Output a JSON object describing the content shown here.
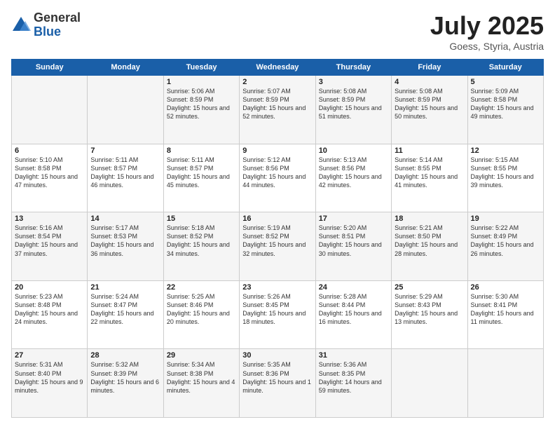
{
  "logo": {
    "general": "General",
    "blue": "Blue"
  },
  "header": {
    "month": "July 2025",
    "location": "Goess, Styria, Austria"
  },
  "weekdays": [
    "Sunday",
    "Monday",
    "Tuesday",
    "Wednesday",
    "Thursday",
    "Friday",
    "Saturday"
  ],
  "weeks": [
    [
      {
        "day": "",
        "sunrise": "",
        "sunset": "",
        "daylight": ""
      },
      {
        "day": "",
        "sunrise": "",
        "sunset": "",
        "daylight": ""
      },
      {
        "day": "1",
        "sunrise": "Sunrise: 5:06 AM",
        "sunset": "Sunset: 8:59 PM",
        "daylight": "Daylight: 15 hours and 52 minutes."
      },
      {
        "day": "2",
        "sunrise": "Sunrise: 5:07 AM",
        "sunset": "Sunset: 8:59 PM",
        "daylight": "Daylight: 15 hours and 52 minutes."
      },
      {
        "day": "3",
        "sunrise": "Sunrise: 5:08 AM",
        "sunset": "Sunset: 8:59 PM",
        "daylight": "Daylight: 15 hours and 51 minutes."
      },
      {
        "day": "4",
        "sunrise": "Sunrise: 5:08 AM",
        "sunset": "Sunset: 8:59 PM",
        "daylight": "Daylight: 15 hours and 50 minutes."
      },
      {
        "day": "5",
        "sunrise": "Sunrise: 5:09 AM",
        "sunset": "Sunset: 8:58 PM",
        "daylight": "Daylight: 15 hours and 49 minutes."
      }
    ],
    [
      {
        "day": "6",
        "sunrise": "Sunrise: 5:10 AM",
        "sunset": "Sunset: 8:58 PM",
        "daylight": "Daylight: 15 hours and 47 minutes."
      },
      {
        "day": "7",
        "sunrise": "Sunrise: 5:11 AM",
        "sunset": "Sunset: 8:57 PM",
        "daylight": "Daylight: 15 hours and 46 minutes."
      },
      {
        "day": "8",
        "sunrise": "Sunrise: 5:11 AM",
        "sunset": "Sunset: 8:57 PM",
        "daylight": "Daylight: 15 hours and 45 minutes."
      },
      {
        "day": "9",
        "sunrise": "Sunrise: 5:12 AM",
        "sunset": "Sunset: 8:56 PM",
        "daylight": "Daylight: 15 hours and 44 minutes."
      },
      {
        "day": "10",
        "sunrise": "Sunrise: 5:13 AM",
        "sunset": "Sunset: 8:56 PM",
        "daylight": "Daylight: 15 hours and 42 minutes."
      },
      {
        "day": "11",
        "sunrise": "Sunrise: 5:14 AM",
        "sunset": "Sunset: 8:55 PM",
        "daylight": "Daylight: 15 hours and 41 minutes."
      },
      {
        "day": "12",
        "sunrise": "Sunrise: 5:15 AM",
        "sunset": "Sunset: 8:55 PM",
        "daylight": "Daylight: 15 hours and 39 minutes."
      }
    ],
    [
      {
        "day": "13",
        "sunrise": "Sunrise: 5:16 AM",
        "sunset": "Sunset: 8:54 PM",
        "daylight": "Daylight: 15 hours and 37 minutes."
      },
      {
        "day": "14",
        "sunrise": "Sunrise: 5:17 AM",
        "sunset": "Sunset: 8:53 PM",
        "daylight": "Daylight: 15 hours and 36 minutes."
      },
      {
        "day": "15",
        "sunrise": "Sunrise: 5:18 AM",
        "sunset": "Sunset: 8:52 PM",
        "daylight": "Daylight: 15 hours and 34 minutes."
      },
      {
        "day": "16",
        "sunrise": "Sunrise: 5:19 AM",
        "sunset": "Sunset: 8:52 PM",
        "daylight": "Daylight: 15 hours and 32 minutes."
      },
      {
        "day": "17",
        "sunrise": "Sunrise: 5:20 AM",
        "sunset": "Sunset: 8:51 PM",
        "daylight": "Daylight: 15 hours and 30 minutes."
      },
      {
        "day": "18",
        "sunrise": "Sunrise: 5:21 AM",
        "sunset": "Sunset: 8:50 PM",
        "daylight": "Daylight: 15 hours and 28 minutes."
      },
      {
        "day": "19",
        "sunrise": "Sunrise: 5:22 AM",
        "sunset": "Sunset: 8:49 PM",
        "daylight": "Daylight: 15 hours and 26 minutes."
      }
    ],
    [
      {
        "day": "20",
        "sunrise": "Sunrise: 5:23 AM",
        "sunset": "Sunset: 8:48 PM",
        "daylight": "Daylight: 15 hours and 24 minutes."
      },
      {
        "day": "21",
        "sunrise": "Sunrise: 5:24 AM",
        "sunset": "Sunset: 8:47 PM",
        "daylight": "Daylight: 15 hours and 22 minutes."
      },
      {
        "day": "22",
        "sunrise": "Sunrise: 5:25 AM",
        "sunset": "Sunset: 8:46 PM",
        "daylight": "Daylight: 15 hours and 20 minutes."
      },
      {
        "day": "23",
        "sunrise": "Sunrise: 5:26 AM",
        "sunset": "Sunset: 8:45 PM",
        "daylight": "Daylight: 15 hours and 18 minutes."
      },
      {
        "day": "24",
        "sunrise": "Sunrise: 5:28 AM",
        "sunset": "Sunset: 8:44 PM",
        "daylight": "Daylight: 15 hours and 16 minutes."
      },
      {
        "day": "25",
        "sunrise": "Sunrise: 5:29 AM",
        "sunset": "Sunset: 8:43 PM",
        "daylight": "Daylight: 15 hours and 13 minutes."
      },
      {
        "day": "26",
        "sunrise": "Sunrise: 5:30 AM",
        "sunset": "Sunset: 8:41 PM",
        "daylight": "Daylight: 15 hours and 11 minutes."
      }
    ],
    [
      {
        "day": "27",
        "sunrise": "Sunrise: 5:31 AM",
        "sunset": "Sunset: 8:40 PM",
        "daylight": "Daylight: 15 hours and 9 minutes."
      },
      {
        "day": "28",
        "sunrise": "Sunrise: 5:32 AM",
        "sunset": "Sunset: 8:39 PM",
        "daylight": "Daylight: 15 hours and 6 minutes."
      },
      {
        "day": "29",
        "sunrise": "Sunrise: 5:34 AM",
        "sunset": "Sunset: 8:38 PM",
        "daylight": "Daylight: 15 hours and 4 minutes."
      },
      {
        "day": "30",
        "sunrise": "Sunrise: 5:35 AM",
        "sunset": "Sunset: 8:36 PM",
        "daylight": "Daylight: 15 hours and 1 minute."
      },
      {
        "day": "31",
        "sunrise": "Sunrise: 5:36 AM",
        "sunset": "Sunset: 8:35 PM",
        "daylight": "Daylight: 14 hours and 59 minutes."
      },
      {
        "day": "",
        "sunrise": "",
        "sunset": "",
        "daylight": ""
      },
      {
        "day": "",
        "sunrise": "",
        "sunset": "",
        "daylight": ""
      }
    ]
  ]
}
